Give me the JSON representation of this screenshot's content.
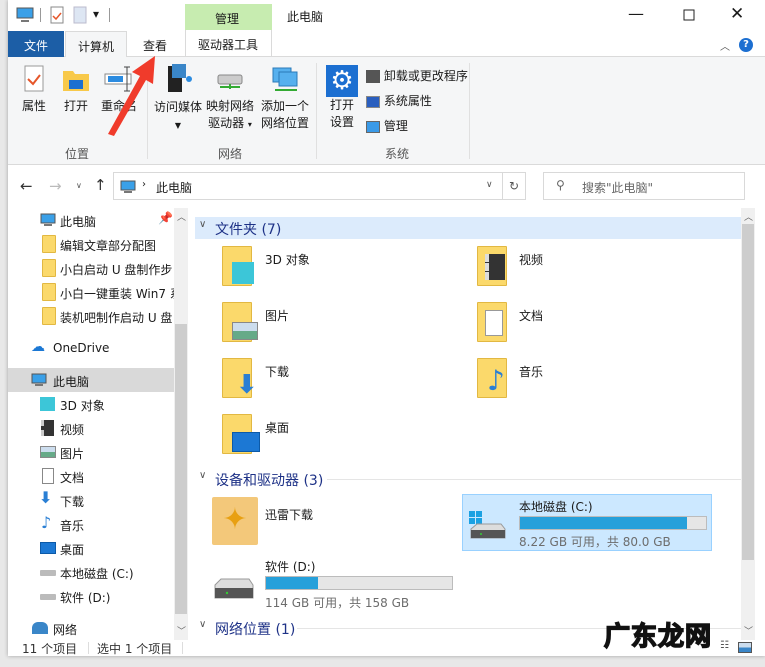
{
  "window": {
    "title": "此电脑",
    "quick_access_dropdown": "▾"
  },
  "tabs": {
    "file": "文件",
    "computer": "计算机",
    "view": "查看",
    "context_group": "管理",
    "drive_tools": "驱动器工具"
  },
  "ribbon": {
    "location": {
      "label": "位置",
      "properties": "属性",
      "open": "打开",
      "rename": "重命名"
    },
    "network": {
      "label": "网络",
      "access_media": "访问媒体",
      "map_drive_1": "映射网络",
      "map_drive_2": "驱动器",
      "add_location_1": "添加一个",
      "add_location_2": "网络位置"
    },
    "system": {
      "label": "系统",
      "open_settings_1": "打开",
      "open_settings_2": "设置",
      "uninstall": "卸载或更改程序",
      "system_props": "系统属性",
      "manage": "管理"
    }
  },
  "address": {
    "path": "此电脑",
    "search_placeholder": "搜索\"此电脑\""
  },
  "nav": {
    "quick_access": [
      {
        "label": "此电脑"
      },
      {
        "label": "编辑文章部分配图"
      },
      {
        "label": "小白启动 U 盘制作步"
      },
      {
        "label": "小白一键重装 Win7 系"
      },
      {
        "label": "装机吧制作启动 U 盘"
      }
    ],
    "onedrive": "OneDrive",
    "this_pc": "此电脑",
    "pc_items": [
      {
        "label": "3D 对象"
      },
      {
        "label": "视频"
      },
      {
        "label": "图片"
      },
      {
        "label": "文档"
      },
      {
        "label": "下载"
      },
      {
        "label": "音乐"
      },
      {
        "label": "桌面"
      },
      {
        "label": "本地磁盘 (C:)"
      },
      {
        "label": "软件 (D:)"
      }
    ],
    "network": "网络"
  },
  "content": {
    "folders_header": "文件夹 (7)",
    "folders": [
      {
        "label": "3D 对象"
      },
      {
        "label": "视频"
      },
      {
        "label": "图片"
      },
      {
        "label": "文档"
      },
      {
        "label": "下载"
      },
      {
        "label": "音乐"
      },
      {
        "label": "桌面"
      }
    ],
    "devices_header": "设备和驱动器 (3)",
    "xunlei": "迅雷下载",
    "drive_c": {
      "label": "本地磁盘 (C:)",
      "info": "8.22 GB 可用，共 80.0 GB",
      "used_fraction": 0.897
    },
    "drive_d": {
      "label": "软件 (D:)",
      "info": "114 GB 可用，共 158 GB",
      "used_fraction": 0.278
    },
    "network_header": "网络位置 (1)"
  },
  "status": {
    "count": "11 个项目",
    "selected": "选中 1 个项目"
  },
  "watermark": "广东龙网"
}
